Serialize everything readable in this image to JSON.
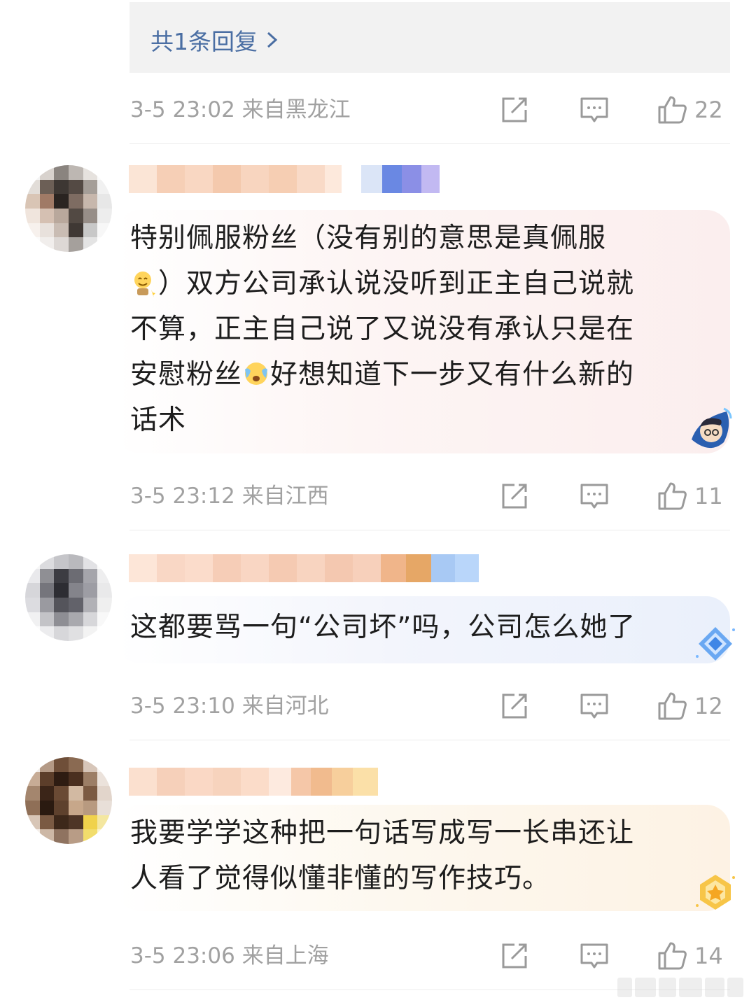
{
  "reply_summary": {
    "label": "共1条回复"
  },
  "comments": [
    {
      "time": "3-5 23:02",
      "location": "来自黑龙江",
      "likes": "22"
    },
    {
      "text_lines": [
        "特别佩服粉丝（没有别的意思是真佩服",
        "）双方公司承认说没听到正主自己说就",
        "不算，正主自己说了又说没有承认只是在",
        "安慰粉丝",
        "好想知道下一步又有什么新的",
        "话术"
      ],
      "time": "3-5 23:12",
      "location": "来自江西",
      "likes": "11",
      "emojis": [
        "smiling-emoji",
        "crying-emoji"
      ]
    },
    {
      "text_lines": [
        "这都要骂一句“公司坏”吗，公司怎么她了"
      ],
      "time": "3-5 23:10",
      "location": "来自河北",
      "likes": "12"
    },
    {
      "text_lines": [
        "我要学学这种把一句话写成写一长串还让",
        "人看了觉得似懂非懂的写作技巧。"
      ],
      "time": "3-5 23:06",
      "location": "来自上海",
      "likes": "14"
    }
  ],
  "colors": {
    "meta_gray": "#a1a1a1",
    "link_blue": "#4a6ea3",
    "reply_bg": "#f2f2f2"
  },
  "icons": [
    "chevron-right-icon",
    "share-icon",
    "comment-icon",
    "like-icon"
  ]
}
